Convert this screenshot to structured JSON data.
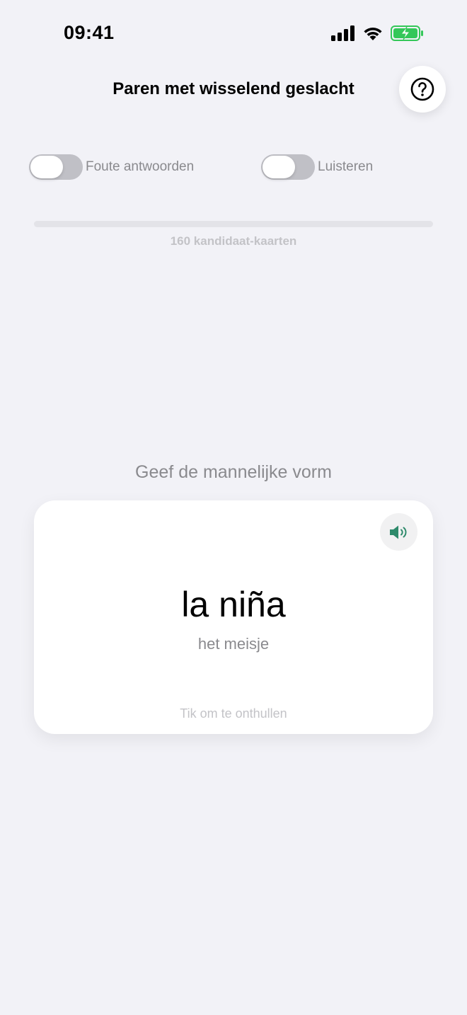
{
  "status_bar": {
    "time": "09:41"
  },
  "header": {
    "title": "Paren met wisselend geslacht",
    "help_icon": "question-circle-icon"
  },
  "toggles": {
    "wrong_answers": {
      "label": "Foute antwoorden",
      "on": false
    },
    "listen": {
      "label": "Luisteren",
      "on": false
    }
  },
  "progress": {
    "value": 0,
    "caption": "160 kandidaat-kaarten"
  },
  "prompt": "Geef de mannelijke vorm",
  "card": {
    "word": "la niña",
    "translation": "het meisje",
    "hint": "Tik om te onthullen",
    "speaker_icon": "speaker-icon"
  },
  "colors": {
    "background": "#f2f2f7",
    "accent": "#2e8a6b",
    "battery": "#34c759"
  }
}
